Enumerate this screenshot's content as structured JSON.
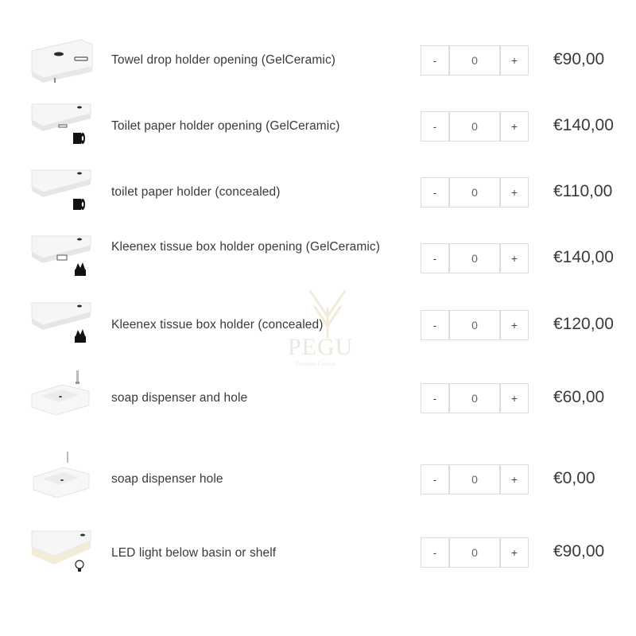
{
  "products": [
    {
      "name": "Towel drop holder opening (GelCeramic)",
      "quantity": "0",
      "minus": "-",
      "plus": "+",
      "price": "€90,00",
      "icon": "towel-drop-slot"
    },
    {
      "name": "Toilet paper holder opening (GelCeramic)",
      "quantity": "0",
      "minus": "-",
      "plus": "+",
      "price": "€140,00",
      "icon": "toilet-paper-roll-icon"
    },
    {
      "name": "toilet paper holder (concealed)",
      "quantity": "0",
      "minus": "-",
      "plus": "+",
      "price": "€110,00",
      "icon": "toilet-paper-roll-icon"
    },
    {
      "name": "Kleenex tissue box holder opening (GelCeramic)",
      "quantity": "0",
      "minus": "-",
      "plus": "+",
      "price": "€140,00",
      "icon": "tissue-box-icon"
    },
    {
      "name": "Kleenex tissue box holder (concealed)",
      "quantity": "0",
      "minus": "-",
      "plus": "+",
      "price": "€120,00",
      "icon": "tissue-box-icon"
    },
    {
      "name": "soap dispenser and hole",
      "quantity": "0",
      "minus": "-",
      "plus": "+",
      "price": "€60,00",
      "icon": "soap-dispenser"
    },
    {
      "name": "soap dispenser hole",
      "quantity": "0",
      "minus": "-",
      "plus": "+",
      "price": "€0,00",
      "icon": "soap-dispenser-hole"
    },
    {
      "name": "LED light below basin or shelf",
      "quantity": "0",
      "minus": "-",
      "plus": "+",
      "price": "€90,00",
      "icon": "light-bulb-icon"
    }
  ],
  "watermark": {
    "brand": "PEGU",
    "tagline": "Furniture Fashion"
  }
}
